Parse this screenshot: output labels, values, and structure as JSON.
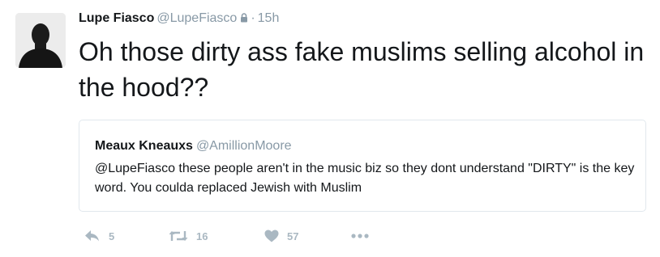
{
  "tweet": {
    "author_name": "Lupe Fiasco",
    "author_handle": "@LupeFiasco",
    "separator": "·",
    "timestamp": "15h",
    "protected_icon": "lock-icon",
    "text": "Oh those dirty ass fake muslims selling alcohol in the hood??"
  },
  "quoted_tweet": {
    "author_name": "Meaux Kneauxs",
    "author_handle": "@AmillionMoore",
    "text": "@LupeFiasco these people aren't in the music biz so they dont understand \"DIRTY\" is the key word. You coulda replaced Jewish with Muslim"
  },
  "actions": {
    "reply_count": "5",
    "retweet_count": "16",
    "like_count": "57",
    "icons": [
      "reply-icon",
      "retweet-icon",
      "heart-icon",
      "more-icon"
    ]
  },
  "colors": {
    "text": "#14171a",
    "muted": "#8899a6",
    "action_icons": "#aab8c2",
    "border": "#e1e8ed"
  }
}
